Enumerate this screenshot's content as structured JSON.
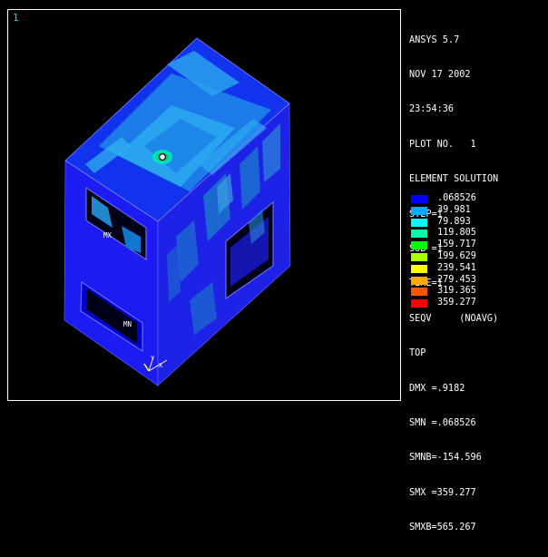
{
  "viewport": {
    "window_number": "1",
    "labels": {
      "mx": "MX",
      "mn": "MN"
    },
    "triad": {
      "y": "Y",
      "x": "X"
    }
  },
  "info": {
    "lines": [
      "ANSYS 5.7",
      "NOV 17 2002",
      "23:54:36",
      "PLOT NO.   1",
      "ELEMENT SOLUTION",
      "STEP=1",
      "SUB =1",
      "TIME=1",
      "SEQV     (NOAVG)",
      "TOP",
      "DMX =.9182",
      "SMN =.068526",
      "SMNB=-154.596",
      "SMX =359.277",
      "SMXB=565.267"
    ]
  },
  "legend": [
    {
      "value": ".068526",
      "color": "#0000ff"
    },
    {
      "value": "39.981",
      "color": "#00aaff"
    },
    {
      "value": "79.893",
      "color": "#00ffff"
    },
    {
      "value": "119.805",
      "color": "#00ffaa"
    },
    {
      "value": "159.717",
      "color": "#00ff00"
    },
    {
      "value": "199.629",
      "color": "#aaff00"
    },
    {
      "value": "239.541",
      "color": "#ffff00"
    },
    {
      "value": "279.453",
      "color": "#ffaa00"
    },
    {
      "value": "319.365",
      "color": "#ff5500"
    },
    {
      "value": "359.277",
      "color": "#ff0000"
    }
  ]
}
